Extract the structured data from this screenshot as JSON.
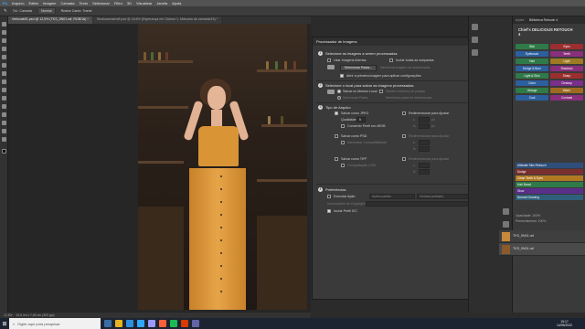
{
  "menu": [
    "Arquivo",
    "Editar",
    "Imagem",
    "Camada",
    "Texto",
    "Selecionar",
    "Filtro",
    "3D",
    "Visualizar",
    "Janela",
    "Ajuda"
  ],
  "options": {
    "tolerance_label": "Tol.: Camada",
    "mode_value": "Normal",
    "sample_label": "Realce Canto: Transf."
  },
  "tabs": [
    "Verlucak01.psd @ 12,5% (TKS_9N01.raf, RGB/16) *",
    "Studioworkshoff.psd @ 16,6% (Esperança em Outono 1, Máscara de camada/16) *"
  ],
  "dialog": {
    "title": "Processador de Imagens",
    "s1_head": "Selecione as imagens a serem processadas",
    "s1_use_open": "Usar Imagens Abertas",
    "s1_include_subfolders": "Incluir todas as subpastas",
    "s1_select_folder": "Selecionar Pasta...",
    "s1_no_images": "Nenhuma imagem foi selecionada",
    "s1_open_first": "Abrir a primeira imagem para aplicar configurações",
    "s2_head": "Selecione o local para salvar as imagens processadas",
    "s2_same_location": "Salvar no Mesmo Local",
    "s2_keep_structure": "Manter estrutura de pastas",
    "s2_select_folder": "Selecionar Pasta...",
    "s2_no_folder": "Nenhuma pasta foi selecionada",
    "s3_head": "Tipo de Arquivo",
    "jpeg": "Salvar como JPEG",
    "resize": "Redimensionar para Ajustar",
    "quality_label": "Qualidade:",
    "quality_value": "5",
    "convert_srgb": "Converter Perfil em sRGB",
    "psd": "Salvar como PSD",
    "maximize": "Maximizar Compatibilidade",
    "tiff": "Salvar como TIFF",
    "lzw": "Compactação LZW",
    "w_label": "L:",
    "h_label": "A:",
    "px": "px",
    "s4_head": "Preferências",
    "run_action": "Executar Ação:",
    "action_set": "Ações padrão",
    "action_name": "Vinheta (seleção)",
    "copyright": "Informações de Copyright:",
    "icc": "Incluir Perfil ICC",
    "btn_run": "Executar",
    "btn_cancel": "Cancelar",
    "btn_load": "Carregar...",
    "btn_save": "Salvar..."
  },
  "panels": {
    "tab1": "Ações",
    "tab2": "Biblioteca Retouch 4",
    "brand": "Chief's DELICIOUS RETOUCH 4",
    "actions": [
      {
        "label": "Skin",
        "color": "#2f7a49"
      },
      {
        "label": "Eyes",
        "color": "#9b2f2f"
      },
      {
        "label": "Eyebrows",
        "color": "#2c5f9e"
      },
      {
        "label": "Teeth",
        "color": "#8a2f7c"
      },
      {
        "label": "Hair",
        "color": "#2f7a49"
      },
      {
        "label": "Light",
        "color": "#9e7a22"
      },
      {
        "label": "Dodge & Burn",
        "color": "#2c5f9e"
      },
      {
        "label": "Shadows",
        "color": "#8a2f7c"
      },
      {
        "label": "Light & Skin",
        "color": "#2f7a49"
      },
      {
        "label": "Sharp",
        "color": "#9b2f2f"
      },
      {
        "label": "Color",
        "color": "#2c5f9e"
      },
      {
        "label": "Cleanup",
        "color": "#7a2f8a"
      },
      {
        "label": "Vintage",
        "color": "#2f7a49"
      },
      {
        "label": "Warm",
        "color": "#9e6a22"
      },
      {
        "label": "Cool",
        "color": "#2c5f9e"
      },
      {
        "label": "Contrast",
        "color": "#8a2f7c"
      }
    ],
    "swatches": [
      {
        "label": "Ultimate Skin Retouch",
        "color": "#2f4f7a"
      },
      {
        "label": "Dodge",
        "color": "#7a2f2f"
      },
      {
        "label": "Clean Teeth & Eyes",
        "color": "#b07a22"
      },
      {
        "label": "Hair Boost",
        "color": "#2f7a49"
      },
      {
        "label": "Glow",
        "color": "#5a2f8a"
      },
      {
        "label": "Normal Cleaning",
        "color": "#2f5f7a"
      }
    ],
    "opacity_label": "Opacidade: 100%",
    "fill_label": "Preenchimento: 100%"
  },
  "layers": [
    {
      "name": "TKS_9N01.raf",
      "thumb": "#c7893a"
    },
    {
      "name": "TKS_9N01.raf",
      "thumb": "#8a5a2c"
    }
  ],
  "status": "19,5 cm x 7,60 cm (300 ppi)",
  "zoom": "12,5%",
  "taskbar": {
    "search": "Digite aqui para pesquisar",
    "time": "19:17",
    "date": "14/05/2022",
    "lang": "POR PTB2"
  }
}
